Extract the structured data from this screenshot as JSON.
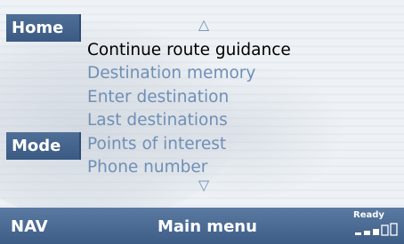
{
  "side_buttons": {
    "home_label": "Home",
    "mode_label": "Mode"
  },
  "menu": {
    "scroll_up_glyph": "△",
    "scroll_down_glyph": "▽",
    "items": [
      {
        "label": "Continue route guidance",
        "selected": true
      },
      {
        "label": "Destination memory",
        "selected": false
      },
      {
        "label": "Enter destination",
        "selected": false
      },
      {
        "label": "Last destinations",
        "selected": false
      },
      {
        "label": "Points of interest",
        "selected": false
      },
      {
        "label": "Phone number",
        "selected": false
      }
    ]
  },
  "status_bar": {
    "nav_label": "NAV",
    "title": "Main menu",
    "ready_label": "Ready",
    "signal_icon": "signal-strength-icon",
    "signal_level": 0.6
  },
  "colors": {
    "accent_blue": "#3f5f88",
    "menu_text": "#6f8fb6",
    "selected_text": "#000000",
    "background": "#eef2f6"
  }
}
